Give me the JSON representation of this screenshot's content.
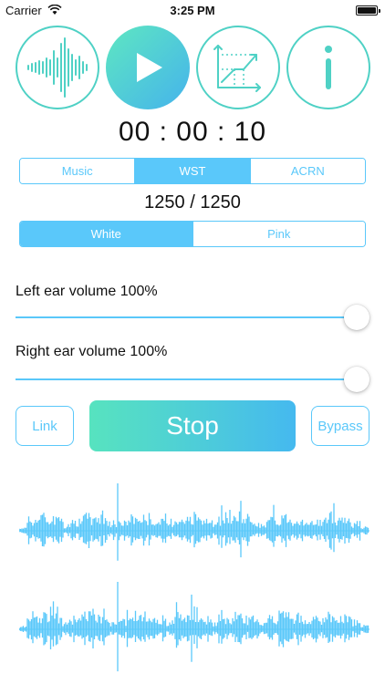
{
  "status_bar": {
    "carrier": "Carrier",
    "time": "3:25 PM"
  },
  "top_buttons": [
    {
      "name": "waveform",
      "icon": "waveform-icon"
    },
    {
      "name": "play",
      "icon": "play-icon"
    },
    {
      "name": "chart",
      "icon": "line-chart-icon"
    },
    {
      "name": "info",
      "icon": "info-icon"
    }
  ],
  "timer": "00 : 00 : 10",
  "mode_tabs": [
    {
      "label": "Music",
      "active": false
    },
    {
      "label": "WST",
      "active": true
    },
    {
      "label": "ACRN",
      "active": false
    }
  ],
  "count": "1250 / 1250",
  "noise_tabs": [
    {
      "label": "White",
      "active": true
    },
    {
      "label": "Pink",
      "active": false
    }
  ],
  "left_ear": {
    "label": "Left ear volume 100%",
    "value": 1.0
  },
  "right_ear": {
    "label": "Right ear volume 100%",
    "value": 1.0
  },
  "actions": {
    "link": "Link",
    "stop": "Stop",
    "bypass": "Bypass"
  },
  "colors": {
    "accent": "#5ac8fa",
    "teal": "#4fd1c5",
    "gradient_start": "#5ee7c1",
    "gradient_end": "#45b3ec",
    "wave": "#5ac8fa"
  }
}
